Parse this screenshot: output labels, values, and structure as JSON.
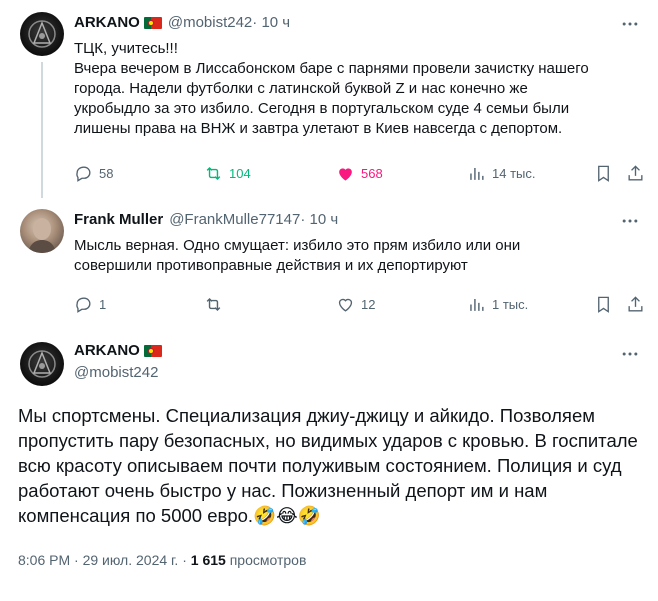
{
  "tweet1": {
    "name": "ARKANO",
    "handle": "@mobist242",
    "time": " · 10 ч",
    "lines": [
      "ТЦК, учитесь!!!",
      "Вчера вечером в Лиссабонском баре с парнями провели зачистку нашего",
      "города. Надели футболки с латинской буквой Z и нас конечно же",
      "укробыдло за это избило. Сегодня в португальском суде  4 семьи были",
      "лишены права на ВНЖ и завтра улетают в Киев навсегда с депортом."
    ],
    "replies": "58",
    "retweets": "104",
    "likes": "568",
    "views": "14 тыс."
  },
  "tweet2": {
    "name": "Frank Muller",
    "handle": "@FrankMulle77147",
    "time": " · 10 ч",
    "lines": [
      "Мысль верная. Одно смущает: избило это прям избило или они",
      "совершили противоправные действия и их депортируют"
    ],
    "replies": "1",
    "retweets": "",
    "likes": "12",
    "views": "1 тыс."
  },
  "tweet3": {
    "name": "ARKANO",
    "handle": "@mobist242",
    "lines": [
      "Мы спортсмены. Специализация джиу-джицу и айкидо. Позволяем",
      "пропустить пару безопасных, но видимых ударов с кровью. В госпитале",
      "всю красоту описываем почти полуживым состоянием. Полиция и суд",
      "работают очень быстро у нас. Пожизненный депорт им и нам",
      "компенсация по 5000 евро.🤣😂🤣"
    ],
    "time_date": "8:06 PM · 29 июл. 2024 г. · ",
    "views_count": "1 615",
    "views_label": " просмотров"
  },
  "colors": {
    "text_primary": "#0f1419",
    "text_secondary": "#536471",
    "retweet_green": "#00ba7c",
    "like_pink": "#f91880",
    "thread_line": "#cfd9de"
  },
  "icons": [
    "more-icon",
    "reply-icon",
    "retweet-icon",
    "like-icon",
    "views-icon",
    "bookmark-icon",
    "share-icon",
    "flag-portugal-icon"
  ]
}
